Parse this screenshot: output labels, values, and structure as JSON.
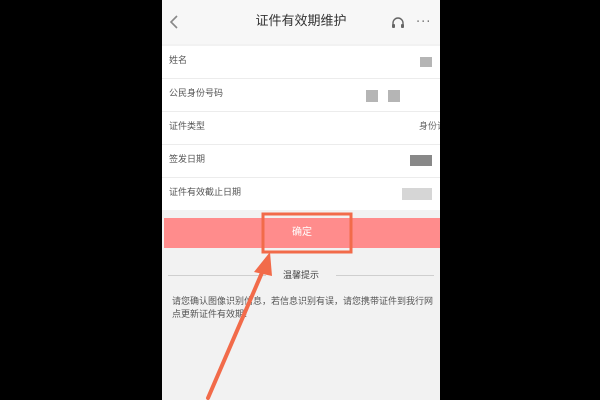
{
  "navbar": {
    "title": "证件有效期维护",
    "back_icon": "chevron-left-icon",
    "more_label": "···",
    "headset_icon": "headset-icon"
  },
  "form": {
    "rows": [
      {
        "label": "姓名",
        "value": ""
      },
      {
        "label": "公民身份号码",
        "value": ""
      },
      {
        "label": "证件类型",
        "value": "身份证"
      },
      {
        "label": "签发日期",
        "value": ""
      },
      {
        "label": "证件有效截止日期",
        "value": ""
      }
    ]
  },
  "confirm": {
    "label": "确定"
  },
  "tips": {
    "title": "温馨提示",
    "text": "请您确认图像识别信息，若信息识别有误，请您携带证件到我行网点更新证件有效期!"
  },
  "colors": {
    "confirm_bg": "#ff8c8c",
    "annotation": "#f26b4a",
    "page_bg": "#f2f2f2"
  }
}
